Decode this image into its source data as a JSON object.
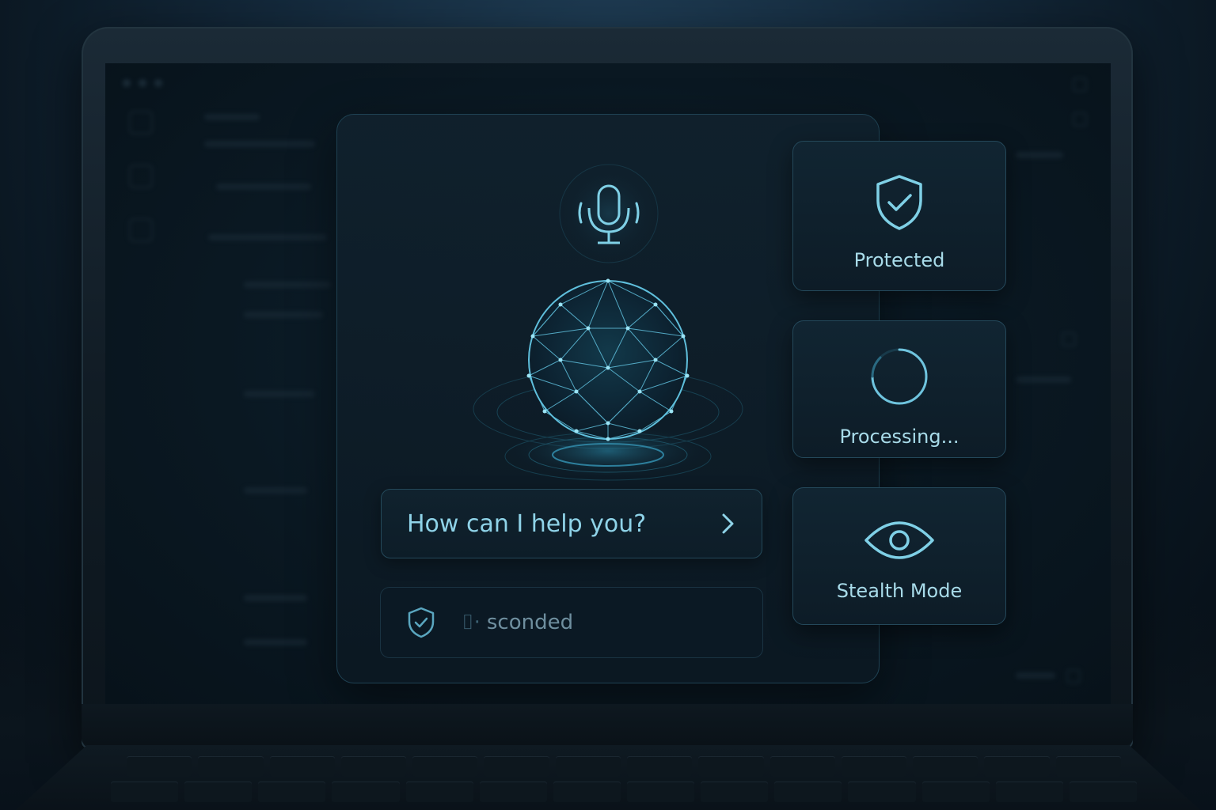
{
  "assistant": {
    "prompt_text": "How can I help you?",
    "status_text": "sconded",
    "status_glyph": "⌷·"
  },
  "cards": {
    "protected": {
      "label": "Protected",
      "icon": "shield-check-icon"
    },
    "processing": {
      "label": "Processing...",
      "icon": "spinner-icon"
    },
    "stealth": {
      "label": "Stealth Mode",
      "icon": "eye-icon"
    }
  },
  "colors": {
    "accent": "#7fd0e6",
    "panel_border": "#24485a",
    "background": "#0a1822"
  }
}
